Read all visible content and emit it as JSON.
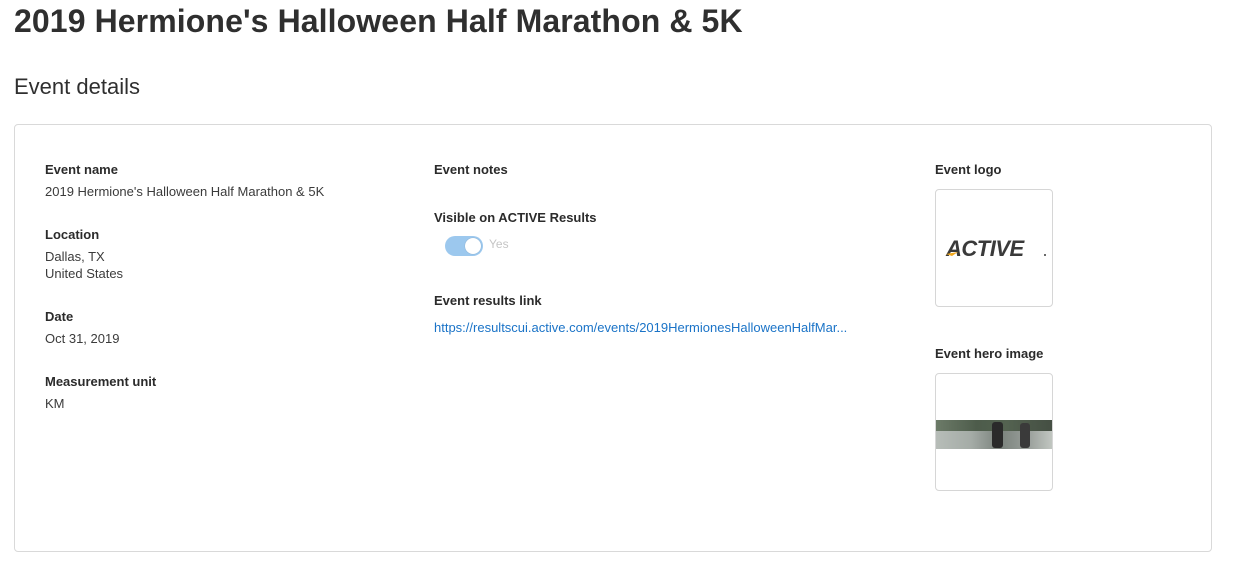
{
  "page": {
    "title": "2019 Hermione's Halloween Half Marathon & 5K"
  },
  "section": {
    "title": "Event details"
  },
  "details": {
    "event_name": {
      "label": "Event name",
      "value": "2019 Hermione's Halloween Half Marathon & 5K"
    },
    "location": {
      "label": "Location",
      "city": "Dallas, TX",
      "country": "United States"
    },
    "date": {
      "label": "Date",
      "value": "Oct 31, 2019"
    },
    "measurement_unit": {
      "label": "Measurement unit",
      "value": "KM"
    }
  },
  "notes": {
    "label": "Event notes"
  },
  "visibility": {
    "label": "Visible on ACTIVE Results",
    "toggle_on": true,
    "toggle_text": "Yes"
  },
  "results_link": {
    "label": "Event results link",
    "text": "https://resultscui.active.com/events/2019HermionesHalloweenHalfMar..."
  },
  "logo": {
    "label": "Event logo",
    "brand_text": "ACTIVE",
    "brand_color": "#3a3a3a",
    "accent_color": "#f2a81d"
  },
  "hero": {
    "label": "Event hero image"
  },
  "colors": {
    "link": "#1a73c7",
    "toggle": "#9cc8ee",
    "border": "#d9d9d9"
  }
}
